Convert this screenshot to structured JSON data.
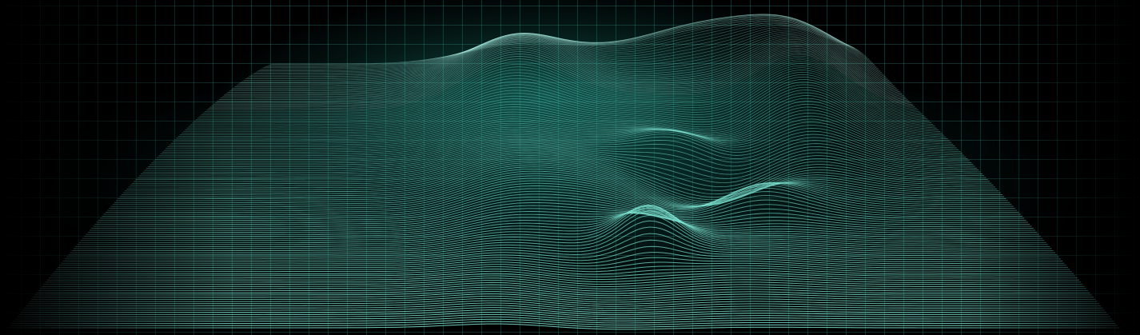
{
  "scene": {
    "subject": "wireframe-terrain",
    "line_color": "#7fe8d6",
    "highlight_color": "#b8fff3",
    "glow_color": "#2ad2b8",
    "background_color": "#000000",
    "grid_color": "#2f6a63"
  }
}
